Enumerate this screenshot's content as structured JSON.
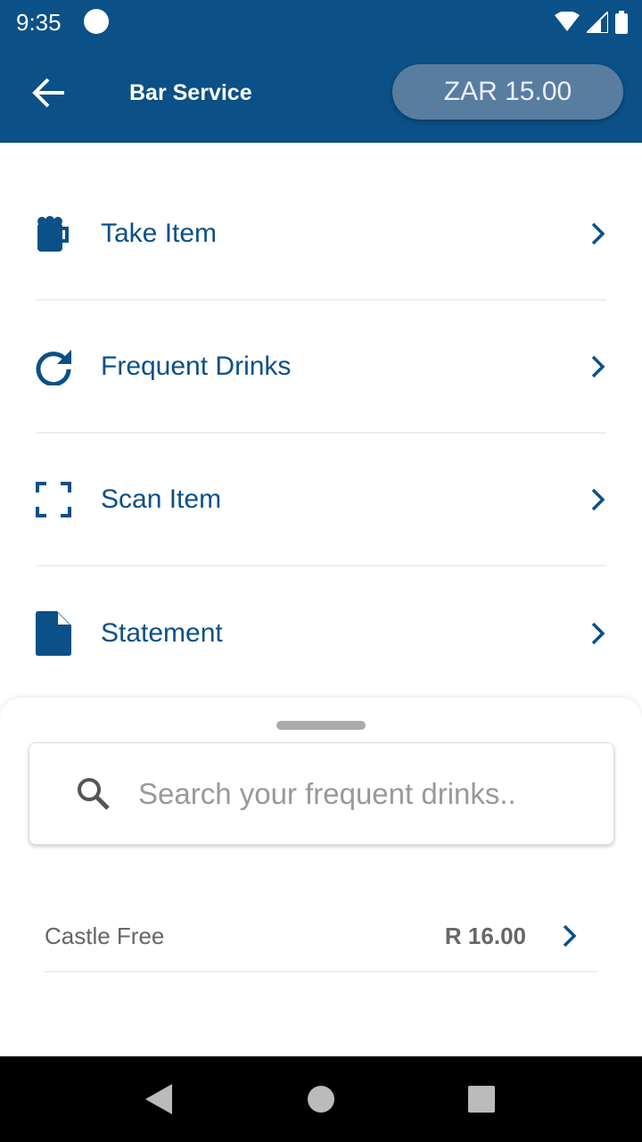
{
  "status_bar": {
    "time": "9:35"
  },
  "header": {
    "title": "Bar Service",
    "balance": "ZAR 15.00"
  },
  "menu": [
    {
      "label": "Take Item",
      "icon": "beer-mug-icon"
    },
    {
      "label": "Frequent Drinks",
      "icon": "refresh-icon"
    },
    {
      "label": "Scan Item",
      "icon": "scan-icon"
    },
    {
      "label": "Statement",
      "icon": "document-icon"
    }
  ],
  "sheet": {
    "search_placeholder": "Search your frequent drinks..",
    "results": [
      {
        "name": "Castle Free",
        "price": "R 16.00"
      }
    ]
  },
  "colors": {
    "primary": "#0b5087"
  }
}
